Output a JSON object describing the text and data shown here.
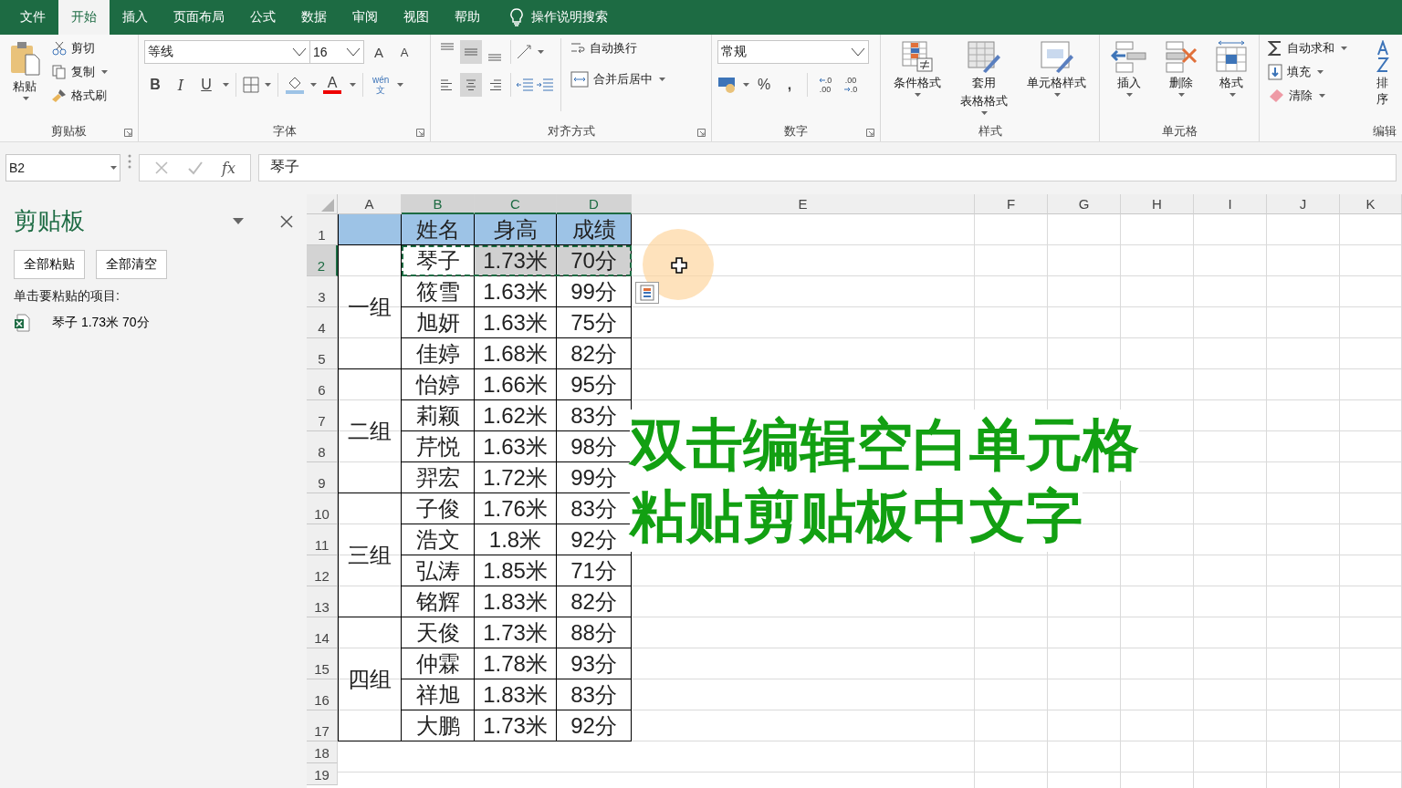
{
  "menu_tabs": [
    {
      "label": "文件",
      "selected": false
    },
    {
      "label": "开始",
      "selected": true
    },
    {
      "label": "插入",
      "selected": false
    },
    {
      "label": "页面布局",
      "selected": false
    },
    {
      "label": "公式",
      "selected": false
    },
    {
      "label": "数据",
      "selected": false
    },
    {
      "label": "审阅",
      "selected": false
    },
    {
      "label": "视图",
      "selected": false
    },
    {
      "label": "帮助",
      "selected": false
    }
  ],
  "tell_me": "操作说明搜索",
  "ribbon": {
    "clipboard": {
      "label": "剪贴板",
      "paste": "粘贴",
      "cut": "剪切",
      "copy": "复制",
      "format_painter": "格式刷"
    },
    "font": {
      "label": "字体",
      "font_name": "等线",
      "font_size": "16",
      "grow": "A",
      "shrink": "A",
      "bold": "B",
      "italic": "I",
      "underline": "U",
      "font_color": "A",
      "phonetic_top": "wén",
      "phonetic_bottom": "文"
    },
    "alignment": {
      "label": "对齐方式",
      "vertical": [
        {
          "kind": "top",
          "selected": false
        },
        {
          "kind": "middle",
          "selected": true
        },
        {
          "kind": "bottom",
          "selected": false
        }
      ],
      "horizontal": [
        {
          "kind": "left",
          "selected": false
        },
        {
          "kind": "center",
          "selected": true
        },
        {
          "kind": "right",
          "selected": false
        }
      ],
      "wrap": "自动换行",
      "merge": "合并后居中"
    },
    "number": {
      "label": "数字",
      "format": "常规",
      "percent": "%",
      "comma": ",",
      "increase_decimal": [
        ".0",
        ".00"
      ],
      "decrease_decimal": [
        ".00",
        ".0"
      ]
    },
    "styles": {
      "label": "样式",
      "buttons": [
        {
          "kind": "conditional",
          "lines": [
            "条件格式"
          ]
        },
        {
          "kind": "table",
          "lines": [
            "套用",
            "表格格式"
          ]
        },
        {
          "kind": "cell",
          "lines": [
            "单元格样式"
          ]
        }
      ]
    },
    "cells": {
      "label": "单元格",
      "buttons": [
        {
          "kind": "insert",
          "label": "插入"
        },
        {
          "kind": "delete",
          "label": "删除"
        },
        {
          "kind": "format",
          "label": "格式"
        }
      ]
    },
    "editing": {
      "label": "编辑",
      "autosum": "自动求和",
      "fill": "填充",
      "clear": "清除",
      "sort": "排序"
    }
  },
  "formula_bar": {
    "name_box": "B2",
    "fx": "fx",
    "content": "琴子"
  },
  "clipboard_pane": {
    "title": "剪贴板",
    "buttons": [
      "全部粘贴",
      "全部清空"
    ],
    "hint": "单击要粘贴的项目:",
    "items": [
      "琴子 1.73米 70分"
    ]
  },
  "sheet": {
    "columns": [
      {
        "label": "A",
        "selected": false
      },
      {
        "label": "B",
        "selected": true
      },
      {
        "label": "C",
        "selected": true
      },
      {
        "label": "D",
        "selected": true
      },
      {
        "label": "E",
        "selected": false
      },
      {
        "label": "F",
        "selected": false
      },
      {
        "label": "G",
        "selected": false
      },
      {
        "label": "H",
        "selected": false
      },
      {
        "label": "I",
        "selected": false
      },
      {
        "label": "J",
        "selected": false
      },
      {
        "label": "K",
        "selected": false
      }
    ],
    "rows": [
      {
        "label": "1",
        "selected": false
      },
      {
        "label": "2",
        "selected": true
      },
      {
        "label": "3",
        "selected": false
      },
      {
        "label": "4",
        "selected": false
      },
      {
        "label": "5",
        "selected": false
      },
      {
        "label": "6",
        "selected": false
      },
      {
        "label": "7",
        "selected": false
      },
      {
        "label": "8",
        "selected": false
      },
      {
        "label": "9",
        "selected": false
      },
      {
        "label": "10",
        "selected": false
      },
      {
        "label": "11",
        "selected": false
      },
      {
        "label": "12",
        "selected": false
      },
      {
        "label": "13",
        "selected": false
      },
      {
        "label": "14",
        "selected": false
      },
      {
        "label": "15",
        "selected": false
      },
      {
        "label": "16",
        "selected": false
      },
      {
        "label": "17",
        "selected": false
      },
      {
        "label": "18",
        "selected": false
      },
      {
        "label": "19",
        "selected": false
      }
    ],
    "header": [
      "姓名",
      "身高",
      "成绩"
    ],
    "groups": [
      {
        "name": "一组",
        "records": [
          {
            "name": "琴子",
            "height": "1.73米",
            "score": "70分",
            "selected": true
          },
          {
            "name": "筱雪",
            "height": "1.63米",
            "score": "99分",
            "selected": false
          },
          {
            "name": "旭妍",
            "height": "1.63米",
            "score": "75分",
            "selected": false
          },
          {
            "name": "佳婷",
            "height": "1.68米",
            "score": "82分",
            "selected": false
          }
        ]
      },
      {
        "name": "二组",
        "records": [
          {
            "name": "怡婷",
            "height": "1.66米",
            "score": "95分",
            "selected": false
          },
          {
            "name": "莉颖",
            "height": "1.62米",
            "score": "83分",
            "selected": false
          },
          {
            "name": "芹悦",
            "height": "1.63米",
            "score": "98分",
            "selected": false
          },
          {
            "name": "羿宏",
            "height": "1.72米",
            "score": "99分",
            "selected": false
          }
        ]
      },
      {
        "name": "三组",
        "records": [
          {
            "name": "子俊",
            "height": "1.76米",
            "score": "83分",
            "selected": false
          },
          {
            "name": "浩文",
            "height": "1.8米",
            "score": "92分",
            "selected": false
          },
          {
            "name": "弘涛",
            "height": "1.85米",
            "score": "71分",
            "selected": false
          },
          {
            "name": "铭辉",
            "height": "1.83米",
            "score": "82分",
            "selected": false
          }
        ]
      },
      {
        "name": "四组",
        "records": [
          {
            "name": "天俊",
            "height": "1.73米",
            "score": "88分",
            "selected": false
          },
          {
            "name": "仲霖",
            "height": "1.78米",
            "score": "93分",
            "selected": false
          },
          {
            "name": "祥旭",
            "height": "1.83米",
            "score": "83分",
            "selected": false
          },
          {
            "name": "大鹏",
            "height": "1.73米",
            "score": "92分",
            "selected": false
          }
        ]
      }
    ]
  },
  "caption": [
    "双击编辑空白单元格",
    "粘贴剪贴板中文字"
  ]
}
